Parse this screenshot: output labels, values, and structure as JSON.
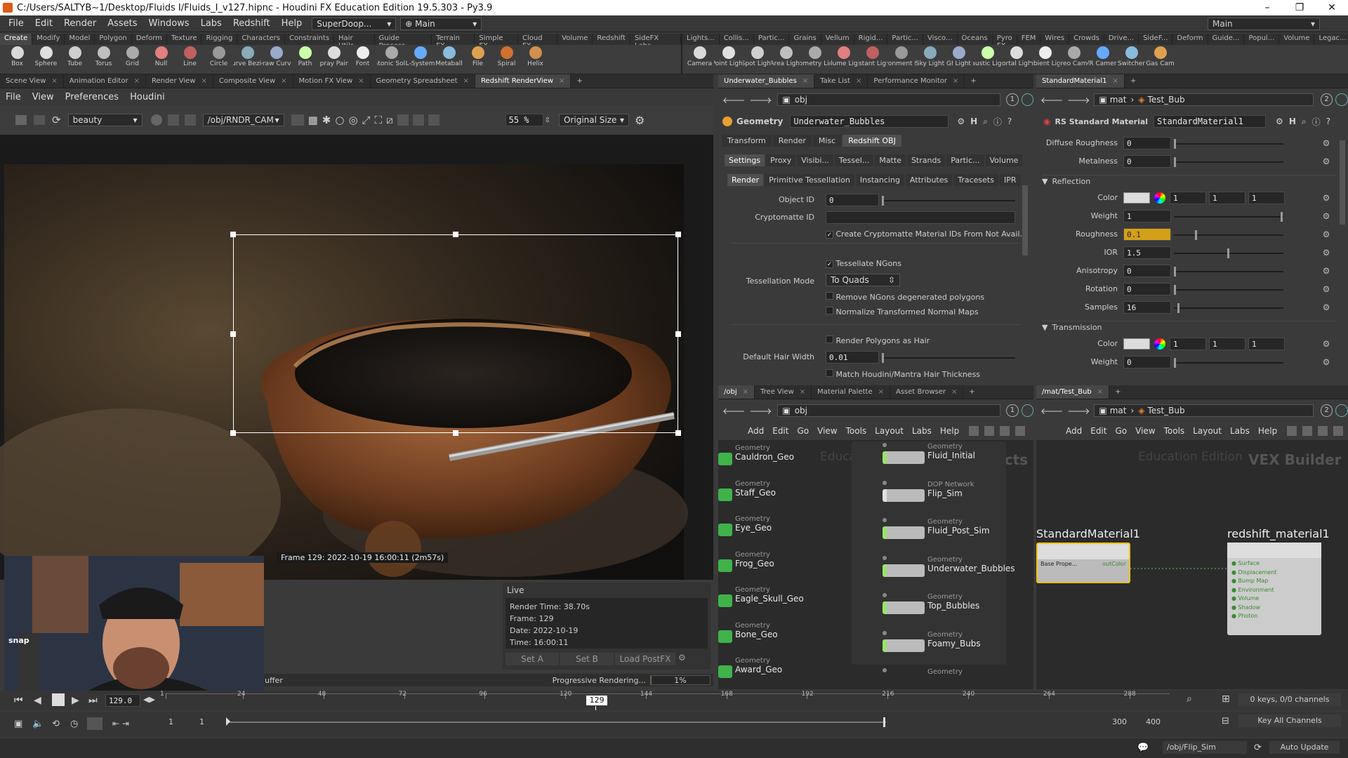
{
  "window": {
    "title": "C:/Users/SALTYB~1/Desktop/Fluids I/Fluids_I_v127.hipnc - Houdini FX Education Edition 19.5.303 - Py3.9",
    "controls": [
      "–",
      "❐",
      "✕"
    ]
  },
  "menubar": {
    "items": [
      "File",
      "Edit",
      "Render",
      "Assets",
      "Windows",
      "Labs",
      "Redshift",
      "Help"
    ],
    "desktop": "SuperDoop...",
    "desk_label": "Main",
    "right_label": "Main"
  },
  "shelf": {
    "tabs_left": [
      "Create",
      "Modify",
      "Model",
      "Polygon",
      "Deform",
      "Texture",
      "Rigging",
      "Characters",
      "Constraints",
      "Hair Utils",
      "Guide Process",
      "Terrain FX",
      "Simple FX",
      "Cloud FX",
      "Volume",
      "Redshift",
      "SideFX Labs"
    ],
    "tabs_right": [
      "Lights...",
      "Collis...",
      "Partic...",
      "Grains",
      "Vellum",
      "Rigid...",
      "Partic...",
      "Visco...",
      "Oceans",
      "Pyro FX",
      "FEM",
      "Wires",
      "Crowds",
      "Drive...",
      "SideF...",
      "Deform",
      "Guide...",
      "Popul...",
      "Volume",
      "Legac..."
    ],
    "tools_left": [
      "Box",
      "Sphere",
      "Tube",
      "Torus",
      "Grid",
      "Null",
      "Line",
      "Circle",
      "Curve Bezier",
      "Draw Curve",
      "Path",
      "Spray Paint",
      "Font",
      "Platonic Solids",
      "L-System",
      "Metaball",
      "File",
      "Spiral",
      "Helix"
    ],
    "tools_right": [
      "Camera",
      "Point Light",
      "Spot Light",
      "Area Light",
      "Geometry Light",
      "Volume Light",
      "Distant Light",
      "Environment Light",
      "Sky Light",
      "GI Light",
      "Caustic Light",
      "Portal Light",
      "Ambient Light",
      "Stereo Camera",
      "VR Camera",
      "Switcher",
      "Gas Cam"
    ]
  },
  "viewer": {
    "tabs": [
      "Scene View",
      "Animation Editor",
      "Render View",
      "Composite View",
      "Motion FX View",
      "Geometry Spreadsheet",
      "Redshift RenderView"
    ],
    "active_tab": "Redshift RenderView",
    "menu": [
      "File",
      "View",
      "Preferences",
      "Houdini"
    ],
    "aov": "beauty",
    "camera": "/obj/RNDR_CAM",
    "zoom": "55 %",
    "size_mode": "Original Size",
    "frame_overlay": "Frame 129: 2022-10-19 16:00:11 (2m57s)",
    "live_label": "Live",
    "stats": [
      "Render Time: 38.70s",
      "Frame: 129",
      "Date: 2022-10-19",
      "Time: 16:00:11"
    ],
    "buttons": [
      "Set A",
      "Set B",
      "Load PostFX"
    ],
    "buffer_label": "uffer",
    "snap_label": "snap",
    "progress_label": "Progressive Rendering...",
    "progress_value": "1%"
  },
  "params": {
    "tabs": [
      "Underwater_Bubbles",
      "Take List",
      "Performance Monitor"
    ],
    "path": "obj",
    "node_type": "Geometry",
    "node_name": "Underwater_Bubbles",
    "top_tabs": [
      "Transform",
      "Render",
      "Misc",
      "Redshift OBJ"
    ],
    "sub_tabs": [
      "Settings",
      "Proxy",
      "Visibi...",
      "Tessel...",
      "Matte",
      "Strands",
      "Partic...",
      "Volume"
    ],
    "sub_sub_tabs": [
      "Render",
      "Primitive Tessellation",
      "Instancing",
      "Attributes",
      "Tracesets",
      "IPR"
    ],
    "object_id_label": "Object ID",
    "object_id": "0",
    "cryptomatte_label": "Cryptomatte ID",
    "cryptomatte_check": "Create Cryptomatte Material IDs From Not Avail...",
    "tessellate": "Tessellate NGons",
    "tess_mode_label": "Tessellation Mode",
    "tess_mode": "To Quads",
    "remove_ngons": "Remove NGons degenerated polygons",
    "normalize": "Normalize Transformed Normal Maps",
    "render_hair": "Render Polygons as Hair",
    "hair_width_label": "Default Hair Width",
    "hair_width": "0.01",
    "match_hair": "Match Houdini/Mantra Hair Thickness"
  },
  "material": {
    "tab": "StandardMaterial1",
    "path": [
      "mat",
      "Test_Bub"
    ],
    "type": "RS Standard Material",
    "name": "StandardMaterial1",
    "rows_top": [
      {
        "label": "Diffuse Roughness",
        "value": "0",
        "pos": 0
      },
      {
        "label": "Metalness",
        "value": "0",
        "pos": 0
      }
    ],
    "reflection_header": "Reflection",
    "reflection": [
      {
        "label": "Color",
        "value": "",
        "rgb": [
          "1",
          "1",
          "1"
        ]
      },
      {
        "label": "Weight",
        "value": "1",
        "pos": 1
      },
      {
        "label": "Roughness",
        "value": "0.1",
        "pos": 0.2
      },
      {
        "label": "IOR",
        "value": "1.5",
        "pos": 0.5
      },
      {
        "label": "Anisotropy",
        "value": "0",
        "pos": 0
      },
      {
        "label": "Rotation",
        "value": "0",
        "pos": 0
      },
      {
        "label": "Samples",
        "value": "16",
        "pos": 0.03
      }
    ],
    "transmission_header": "Transmission",
    "transmission": [
      {
        "label": "Color",
        "value": "",
        "rgb": [
          "1",
          "1",
          "1"
        ]
      },
      {
        "label": "Weight",
        "value": "0",
        "pos": 0
      }
    ]
  },
  "obj_net": {
    "tabs": [
      "/obj",
      "Tree View",
      "Material Palette",
      "Asset Browser"
    ],
    "path": "obj",
    "menu": [
      "Add",
      "Edit",
      "Go",
      "View",
      "Tools",
      "Layout",
      "Labs",
      "Help"
    ],
    "watermark": "Education Edition",
    "context": "Objects",
    "left_nodes": [
      {
        "cat": "Geometry",
        "name": "Cauldron_Geo"
      },
      {
        "cat": "Geometry",
        "name": "Staff_Geo"
      },
      {
        "cat": "Geometry",
        "name": "Eye_Geo"
      },
      {
        "cat": "Geometry",
        "name": "Frog_Geo"
      },
      {
        "cat": "Geometry",
        "name": "Eagle_Skull_Geo"
      },
      {
        "cat": "Geometry",
        "name": "Bone_Geo"
      },
      {
        "cat": "Geometry",
        "name": "Award_Geo"
      }
    ],
    "right_nodes": [
      {
        "cat": "Geometry",
        "name": "Fluid_Initial"
      },
      {
        "cat": "DOP Network",
        "name": "Flip_Sim"
      },
      {
        "cat": "Geometry",
        "name": "Fluid_Post_Sim"
      },
      {
        "cat": "Geometry",
        "name": "Underwater_Bubbles"
      },
      {
        "cat": "Geometry",
        "name": "Top_Bubbles"
      },
      {
        "cat": "Geometry",
        "name": "Foamy_Bubs"
      },
      {
        "cat": "Geometry",
        "name": ""
      }
    ]
  },
  "mat_net": {
    "tab": "/mat/Test_Bub",
    "path": [
      "mat",
      "Test_Bub"
    ],
    "menu": [
      "Add",
      "Edit",
      "Go",
      "View",
      "Tools",
      "Layout",
      "Labs",
      "Help"
    ],
    "watermark": "Education Edition",
    "context": "VEX Builder",
    "node_a": {
      "title": "StandardMaterial1",
      "in_label": "Base Prope...",
      "out_label": "outColor"
    },
    "node_b": {
      "title": "redshift_material1",
      "inputs": [
        "Surface",
        "Displacement",
        "Bump Map",
        "Environment",
        "Volume",
        "Shadow",
        "Photon"
      ]
    }
  },
  "timeline": {
    "frame": "129.0",
    "marker": "129",
    "ticks": [
      "1",
      "24",
      "48",
      "72",
      "96",
      "120",
      "144",
      "168",
      "192",
      "216",
      "240",
      "264",
      "288"
    ],
    "start": "1",
    "start2": "1",
    "end": "300",
    "end2": "400",
    "keys": "0 keys, 0/0 channels",
    "key_all": "Key All Channels"
  },
  "statusbar": {
    "path": "/obj/Flip_Sim",
    "update": "Auto Update"
  },
  "colors": {
    "accent_yellow": "#f3c318",
    "node_green": "#3fb24a",
    "bg": "#3a3a3a"
  }
}
